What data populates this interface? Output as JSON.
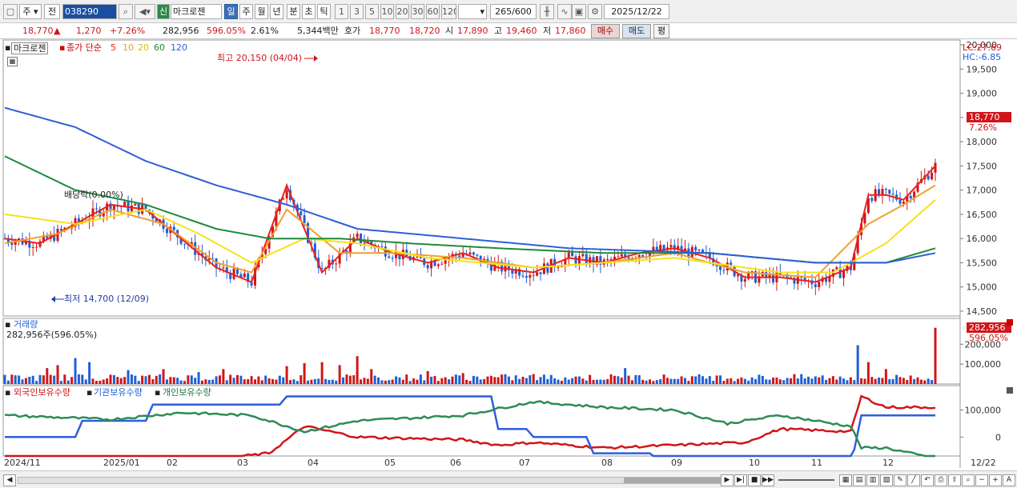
{
  "toolbar": {
    "kind": "주",
    "all": "전",
    "code": "038290",
    "name": "마크로젠",
    "new_label": "신",
    "periods": [
      "일",
      "주",
      "월",
      "년",
      "분",
      "초",
      "틱"
    ],
    "minutes": [
      "1",
      "3",
      "5",
      "10",
      "20",
      "30",
      "60",
      "120"
    ],
    "count": "265",
    "count_max": "/600",
    "date": "2025/12/22"
  },
  "quote": {
    "price": "18,770",
    "change_arrow": "▲",
    "change": "1,270",
    "change_pct": "+7.26%",
    "volume": "282,956",
    "volume_pct": "596.05%",
    "turnover_pct": "2.61%",
    "amount": "5,344백만",
    "bid_label": "호가",
    "ask_price": "18,770",
    "bid_price": "18,720",
    "open_label": "시",
    "open": "17,890",
    "high_label": "고",
    "high": "19,460",
    "low_label": "저",
    "low": "17,860",
    "buy_label": "매수",
    "sell_label": "매도",
    "extra_label": "평"
  },
  "main_panel": {
    "stock_label": "마크로젠",
    "ma_title": "종가 단순",
    "ma_periods": [
      "5",
      "10",
      "20",
      "60",
      "120"
    ],
    "lc": "LC:27.69",
    "hc": "HC:-6.85",
    "high_note": "최고 20,150 (04/04)",
    "low_note": "최저 14,700 (12/09)",
    "dividend_note": "배당락(0.00%)",
    "last_price_tag": "18,770",
    "last_pct_tag": "7.26%"
  },
  "volume_panel": {
    "title": "거래량",
    "value": "282,956주(596.05%)",
    "tag_value": "282,956",
    "tag_pct": "596.05%"
  },
  "holdings_panel": {
    "titles": [
      "외국인보유수량",
      "기관보유수량",
      "개인보유수량"
    ]
  },
  "x_labels": [
    "2024/11",
    "2025/01",
    "02",
    "03",
    "04",
    "05",
    "06",
    "07",
    "08",
    "09",
    "10",
    "11",
    "12",
    "12/22"
  ],
  "colors": {
    "up": "#d0161a",
    "down": "#1f5fd6",
    "ma5": "#e8231b",
    "ma10": "#f0a030",
    "ma20": "#f5e21c",
    "ma60": "#1f8a3a",
    "ma120": "#2f5fd8",
    "foreign": "#d0161a",
    "institution": "#2f5fd8",
    "individual": "#2e8b57"
  },
  "chart_data": [
    {
      "type": "candlestick",
      "title": "마크로젠",
      "ylim": [
        14400,
        20100
      ],
      "y_ticks": [
        14500,
        15000,
        15500,
        16000,
        16500,
        17000,
        17500,
        18000,
        18500,
        19000,
        19500,
        20000
      ],
      "y_tick_labels": [
        "14,500",
        "15,000",
        "15,500",
        "16,000",
        "16,500",
        "17,000",
        "17,500",
        "18,000",
        "18,500",
        "19,000",
        "19,500",
        "20,000"
      ],
      "series": [
        {
          "name": "5",
          "anchors": [
            [
              0,
              16000
            ],
            [
              10,
              15900
            ],
            [
              20,
              16300
            ],
            [
              30,
              16700
            ],
            [
              40,
              16600
            ],
            [
              50,
              16000
            ],
            [
              60,
              15400
            ],
            [
              70,
              15100
            ],
            [
              80,
              17100
            ],
            [
              90,
              15300
            ],
            [
              100,
              16000
            ],
            [
              110,
              15700
            ],
            [
              120,
              15500
            ],
            [
              130,
              15700
            ],
            [
              140,
              15400
            ],
            [
              150,
              15300
            ],
            [
              160,
              15600
            ],
            [
              170,
              15500
            ],
            [
              180,
              15700
            ],
            [
              190,
              15800
            ],
            [
              200,
              15600
            ],
            [
              210,
              15200
            ],
            [
              220,
              15200
            ],
            [
              230,
              15100
            ],
            [
              240,
              15400
            ],
            [
              245,
              16900
            ],
            [
              250,
              16900
            ],
            [
              255,
              16800
            ],
            [
              264,
              17500
            ]
          ]
        },
        {
          "name": "10",
          "anchors": [
            [
              0,
              15900
            ],
            [
              15,
              16100
            ],
            [
              30,
              16600
            ],
            [
              45,
              16300
            ],
            [
              60,
              15500
            ],
            [
              70,
              15300
            ],
            [
              80,
              16600
            ],
            [
              95,
              15700
            ],
            [
              110,
              15700
            ],
            [
              130,
              15600
            ],
            [
              150,
              15400
            ],
            [
              170,
              15500
            ],
            [
              190,
              15700
            ],
            [
              210,
              15300
            ],
            [
              230,
              15200
            ],
            [
              245,
              16300
            ],
            [
              255,
              16700
            ],
            [
              264,
              17100
            ]
          ]
        },
        {
          "name": "20",
          "anchors": [
            [
              0,
              16500
            ],
            [
              20,
              16300
            ],
            [
              40,
              16600
            ],
            [
              55,
              16100
            ],
            [
              70,
              15500
            ],
            [
              85,
              16000
            ],
            [
              100,
              15900
            ],
            [
              120,
              15600
            ],
            [
              150,
              15400
            ],
            [
              170,
              15500
            ],
            [
              190,
              15600
            ],
            [
              220,
              15300
            ],
            [
              235,
              15300
            ],
            [
              250,
              15900
            ],
            [
              264,
              16800
            ]
          ]
        },
        {
          "name": "60",
          "anchors": [
            [
              0,
              17700
            ],
            [
              20,
              17000
            ],
            [
              40,
              16700
            ],
            [
              60,
              16200
            ],
            [
              75,
              16000
            ],
            [
              95,
              16000
            ],
            [
              115,
              15900
            ],
            [
              140,
              15800
            ],
            [
              170,
              15700
            ],
            [
              200,
              15700
            ],
            [
              230,
              15500
            ],
            [
              250,
              15500
            ],
            [
              264,
              15800
            ]
          ]
        },
        {
          "name": "120",
          "anchors": [
            [
              0,
              18700
            ],
            [
              20,
              18300
            ],
            [
              40,
              17600
            ],
            [
              60,
              17100
            ],
            [
              80,
              16700
            ],
            [
              100,
              16200
            ],
            [
              130,
              16000
            ],
            [
              160,
              15800
            ],
            [
              200,
              15700
            ],
            [
              230,
              15500
            ],
            [
              250,
              15500
            ],
            [
              264,
              15700
            ]
          ]
        }
      ]
    },
    {
      "type": "bar",
      "title": "거래량",
      "ylim": [
        0,
        330000
      ],
      "y_ticks": [
        100000,
        200000
      ],
      "y_tick_labels": [
        "100,000",
        "200,000"
      ],
      "peaks": [
        [
          12,
          80000
        ],
        [
          15,
          95000
        ],
        [
          20,
          130000
        ],
        [
          24,
          110000
        ],
        [
          35,
          70000
        ],
        [
          45,
          75000
        ],
        [
          55,
          60000
        ],
        [
          62,
          75000
        ],
        [
          80,
          90000
        ],
        [
          85,
          105000
        ],
        [
          90,
          110000
        ],
        [
          95,
          95000
        ],
        [
          100,
          140000
        ],
        [
          104,
          75000
        ],
        [
          120,
          65000
        ],
        [
          130,
          55000
        ],
        [
          150,
          50000
        ],
        [
          176,
          80000
        ],
        [
          200,
          40000
        ],
        [
          242,
          195000
        ],
        [
          245,
          110000
        ],
        [
          250,
          75000
        ],
        [
          264,
          282956
        ]
      ]
    },
    {
      "type": "line",
      "title": "외국인보유수량 / 기관보유수량 / 개인보유수량",
      "ylim": [
        -70000,
        190000
      ],
      "y_ticks": [
        0,
        100000
      ],
      "y_tick_labels": [
        "0",
        "100,000"
      ],
      "series": [
        {
          "name": "외국인보유수량",
          "anchors": [
            [
              0,
              -110000
            ],
            [
              30,
              -95000
            ],
            [
              60,
              -80000
            ],
            [
              75,
              -60000
            ],
            [
              85,
              40000
            ],
            [
              100,
              0
            ],
            [
              130,
              -10000
            ],
            [
              140,
              -30000
            ],
            [
              150,
              -20000
            ],
            [
              170,
              -40000
            ],
            [
              210,
              -20000
            ],
            [
              220,
              30000
            ],
            [
              240,
              20000
            ],
            [
              243,
              150000
            ],
            [
              250,
              110000
            ],
            [
              264,
              110000
            ]
          ]
        },
        {
          "name": "기관보유수량",
          "anchors": [
            [
              0,
              0
            ],
            [
              20,
              0
            ],
            [
              22,
              60000
            ],
            [
              40,
              60000
            ],
            [
              42,
              120000
            ],
            [
              78,
              120000
            ],
            [
              80,
              150000
            ],
            [
              138,
              150000
            ],
            [
              140,
              30000
            ],
            [
              148,
              30000
            ],
            [
              150,
              0
            ],
            [
              165,
              0
            ],
            [
              167,
              -60000
            ],
            [
              183,
              -60000
            ],
            [
              185,
              -110000
            ],
            [
              240,
              -110000
            ],
            [
              243,
              80000
            ],
            [
              264,
              80000
            ]
          ]
        },
        {
          "name": "개인보유수량",
          "anchors": [
            [
              0,
              80000
            ],
            [
              30,
              65000
            ],
            [
              50,
              90000
            ],
            [
              70,
              80000
            ],
            [
              85,
              20000
            ],
            [
              100,
              60000
            ],
            [
              130,
              80000
            ],
            [
              150,
              130000
            ],
            [
              170,
              110000
            ],
            [
              190,
              100000
            ],
            [
              205,
              50000
            ],
            [
              220,
              80000
            ],
            [
              240,
              40000
            ],
            [
              243,
              -40000
            ],
            [
              250,
              -40000
            ],
            [
              264,
              -80000
            ]
          ]
        }
      ]
    }
  ]
}
